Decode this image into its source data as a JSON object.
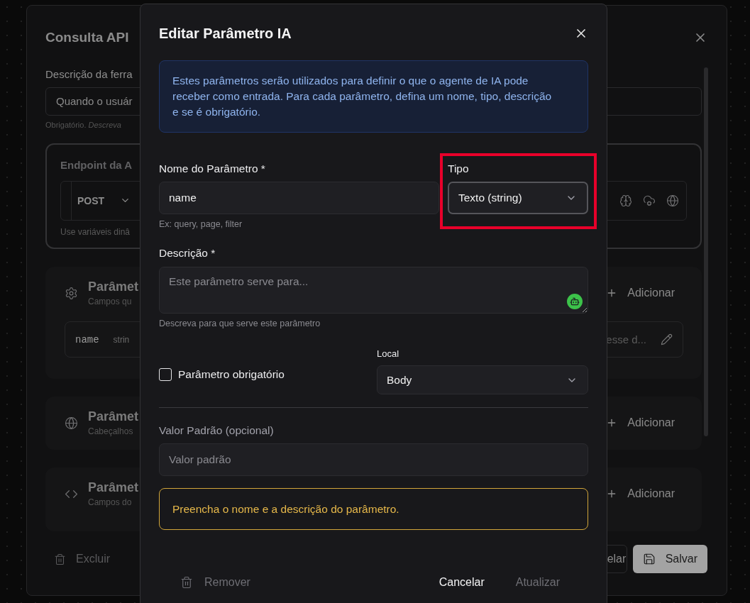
{
  "background_dialog": {
    "title": "Consulta API",
    "description": {
      "label": "Descrição da ferra",
      "value": "Quando o usuár",
      "hint": "Obrigatório. *Descreva*"
    },
    "endpoint": {
      "label": "Endpoint da A",
      "method": "POST",
      "hint": "Use variáveis dinâ"
    },
    "sections": [
      {
        "kind": "gear",
        "title": "Parâmet",
        "subtitle": "Campos qu",
        "action": "Adicionar",
        "params": [
          {
            "name": "name",
            "type": "strin",
            "description": "esse d..."
          }
        ]
      },
      {
        "kind": "globe",
        "title": "Parâmet",
        "subtitle": "Cabeçalhos",
        "action": "Adicionar"
      },
      {
        "kind": "code",
        "title": "Parâmet",
        "subtitle": "Campos do",
        "action": "Adicionar"
      }
    ],
    "footer": {
      "delete": "Excluir",
      "cancel": "elar",
      "save": "Salvar"
    }
  },
  "dialog": {
    "title": "Editar Parâmetro IA",
    "info": "Estes parâmetros serão utilizados para definir o que o agente de IA pode receber como entrada. Para cada parâmetro, defina um nome, tipo, descrição e se é obrigatório.",
    "name_field": {
      "label": "Nome do Parâmetro *",
      "value": "name",
      "hint": "Ex: query, page, filter"
    },
    "type_field": {
      "label": "Tipo",
      "value": "Texto (string)",
      "highlighted": true
    },
    "description_field": {
      "label": "Descrição *",
      "placeholder": "Este parâmetro serve para...",
      "hint": "Descreva para que serve este parâmetro"
    },
    "required": {
      "label": "Parâmetro obrigatório",
      "checked": false
    },
    "location_field": {
      "label": "Local",
      "value": "Body"
    },
    "default_field": {
      "label": "Valor Padrão (opcional)",
      "placeholder": "Valor padrão"
    },
    "warning": "Preencha o nome e a descrição do parâmetro.",
    "buttons": {
      "remove": {
        "label": "Remover",
        "disabled": true
      },
      "cancel": {
        "label": "Cancelar",
        "disabled": false
      },
      "update": {
        "label": "Atualizar",
        "disabled": true
      }
    }
  }
}
